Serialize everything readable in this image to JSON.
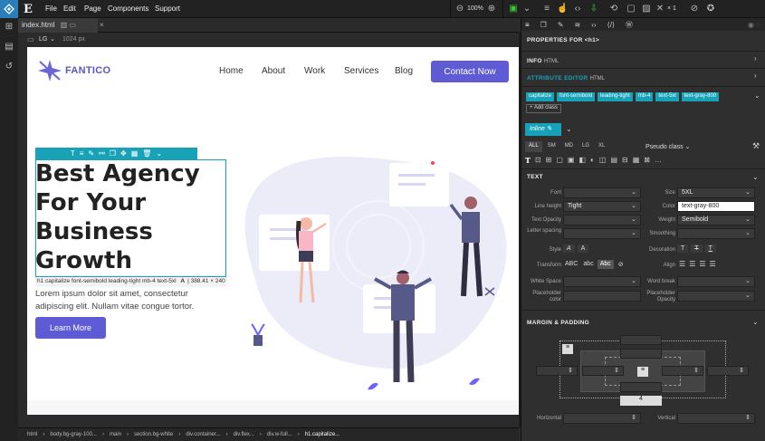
{
  "app": {
    "editor_logo": "E",
    "menu": [
      "File",
      "Edit",
      "Page",
      "Components",
      "Support"
    ],
    "zoom": "100%",
    "count_label": "× 1"
  },
  "file_tab": {
    "name": "index.html"
  },
  "viewport": {
    "size": "LG",
    "width": "1024 px"
  },
  "site": {
    "brand": "FANTICO",
    "nav": [
      "Home",
      "About",
      "Work",
      "Services",
      "Blog"
    ],
    "cta": "Contact Now",
    "hero_title": [
      "Best Agency",
      "For Your",
      "Business",
      "Growth"
    ],
    "hero_text": "Lorem ipsum dolor sit amet, consectetur adipiscing elit. Nullam vitae congue tortor.",
    "learn_more": "Learn More",
    "selection_info": "h1 capitalize font-semibold leading-tight mb-4 text-5xl",
    "selection_size": "388.41 × 240"
  },
  "breadcrumb": [
    "html",
    "body.bg-gray-100...",
    "main",
    "section.bg-white",
    "div.container...",
    "div.flex...",
    "div.w-full...",
    "h1.capitalize..."
  ],
  "panel": {
    "props_title": "PROPERTIES FOR <h1>",
    "info": "INFO",
    "info_sub": "HTML",
    "attr_editor": "ATTRIBUTE EDITOR",
    "attr_sub": "HTML",
    "classes": [
      "capitalize",
      "font-semibold",
      "leading-tight",
      "mb-4",
      "text-5xl",
      "text-gray-800"
    ],
    "add_class": "+ Add class",
    "inline": "Inline",
    "breakpoints": [
      "ALL",
      "SM",
      "MD",
      "LG",
      "XL"
    ],
    "pseudo": "Pseudo class",
    "text_section": "TEXT",
    "font_label": "Font",
    "size_label": "Size",
    "size_value": "5XL",
    "line_height_label": "Line height",
    "line_height_value": "Tight",
    "color_label": "Color",
    "color_value": "text-gray-800",
    "text_opacity_label": "Text Opacity",
    "weight_label": "Weight",
    "weight_value": "Semibold",
    "letter_spacing_label": "Letter spacing",
    "smoothing_label": "Smoothing",
    "style_label": "Style",
    "decoration_label": "Decoration",
    "transform_label": "Transform",
    "transform_opts": [
      "ABC",
      "abc",
      "Abc"
    ],
    "align_label": "Align",
    "white_space_label": "White Space",
    "word_break_label": "Word break",
    "placeholder_color_label": "Placeholder color",
    "placeholder_opacity_label": "Placeholder Opacity",
    "margin_section": "MARGIN & PADDING",
    "margin_bottom_value": "4",
    "horizontal_label": "Horizontal",
    "vertical_label": "Vertical",
    "accent": "#17a2b8"
  }
}
